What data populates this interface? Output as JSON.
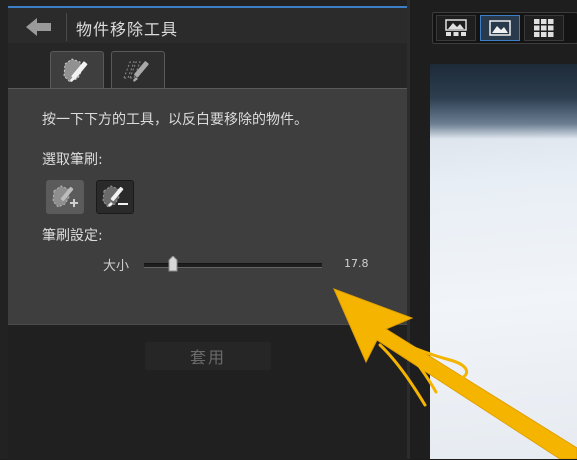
{
  "header": {
    "title": "物件移除工具"
  },
  "panel": {
    "instruction": "按一下下方的工具，以反白要移除的物件。",
    "select_brush_label": "選取筆刷:",
    "brush_settings_label": "筆刷設定:",
    "size_label": "大小",
    "size_value": "17.8",
    "apply_label": "套用"
  },
  "icons": {
    "back": "back-arrow-icon",
    "tab_brush": "object-brush-icon",
    "tab_eraser": "eraser-brush-icon",
    "brush_add": "brush-add-icon",
    "brush_remove": "brush-remove-icon",
    "view_1": "image-grid-icon",
    "view_2": "single-image-icon",
    "view_3": "thumbnail-grid-icon"
  },
  "colors": {
    "accent": "#3d7fc7",
    "annotation_arrow": "#f5b400"
  }
}
